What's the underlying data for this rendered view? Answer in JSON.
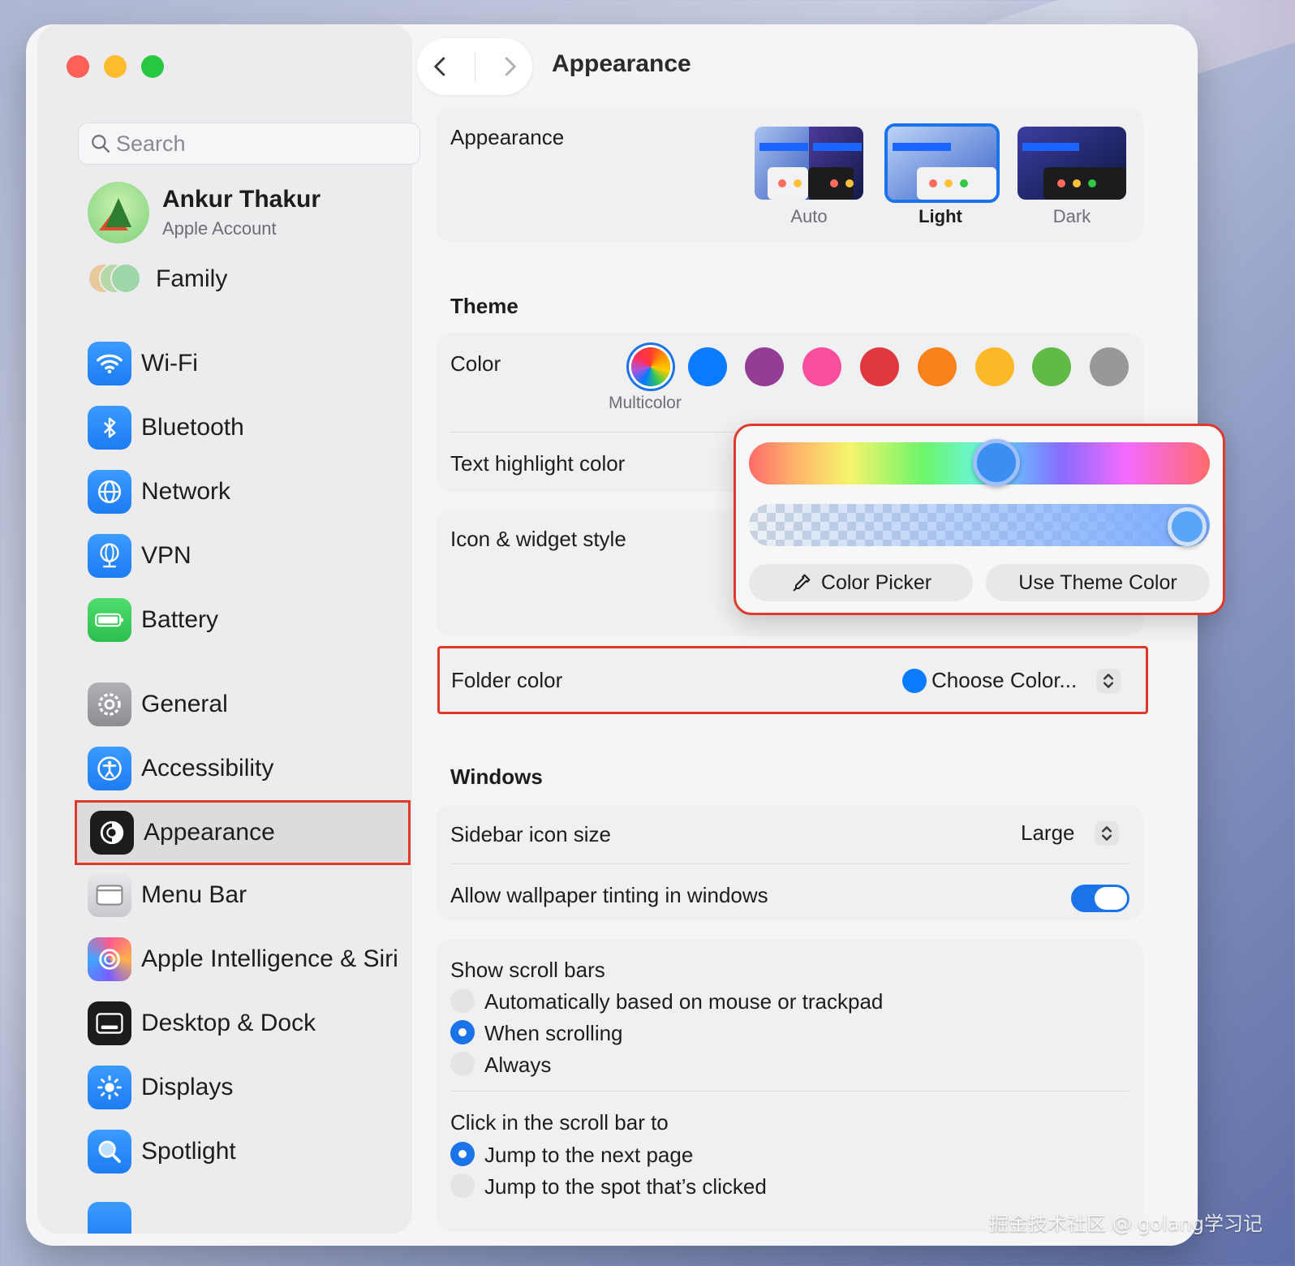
{
  "window": {
    "title": "Appearance"
  },
  "sidebar": {
    "search_placeholder": "Search",
    "account": {
      "name": "Ankur Thakur",
      "subtitle": "Apple Account"
    },
    "family_label": "Family",
    "items": [
      {
        "label": "Wi-Fi",
        "icon": "wifi-icon"
      },
      {
        "label": "Bluetooth",
        "icon": "bluetooth-icon"
      },
      {
        "label": "Network",
        "icon": "globe-icon"
      },
      {
        "label": "VPN",
        "icon": "vpn-globe-icon"
      },
      {
        "label": "Battery",
        "icon": "battery-icon"
      },
      {
        "label": "General",
        "icon": "gear-icon"
      },
      {
        "label": "Accessibility",
        "icon": "accessibility-icon"
      },
      {
        "label": "Appearance",
        "icon": "appearance-icon",
        "selected": true
      },
      {
        "label": "Menu Bar",
        "icon": "menu-bar-icon"
      },
      {
        "label": "Apple Intelligence & Siri",
        "icon": "siri-icon"
      },
      {
        "label": "Desktop & Dock",
        "icon": "dock-icon"
      },
      {
        "label": "Displays",
        "icon": "sun-icon"
      },
      {
        "label": "Spotlight",
        "icon": "magnifier-icon"
      }
    ]
  },
  "main": {
    "appearance": {
      "label": "Appearance",
      "options": [
        {
          "label": "Auto",
          "selected": false
        },
        {
          "label": "Light",
          "selected": true
        },
        {
          "label": "Dark",
          "selected": false
        }
      ]
    },
    "theme": {
      "title": "Theme",
      "color_label": "Color",
      "selected_color": "Multicolor",
      "swatches": [
        "multicolor",
        "#0a7aff",
        "#953d96",
        "#f74f9e",
        "#e0383e",
        "#f7821b",
        "#fcb827",
        "#62ba46",
        "#989898"
      ],
      "text_highlight_label": "Text highlight color",
      "icon_widget_label": "Icon & widget style",
      "popover": {
        "hue_level": 0.57,
        "alpha_level": 1.0,
        "color_picker_label": "Color Picker",
        "use_theme_label": "Use Theme Color"
      },
      "folder_color_label": "Folder color",
      "folder_color_value": "Choose Color...",
      "folder_color_dot": "#0a7aff"
    },
    "windows": {
      "title": "Windows",
      "sidebar_icon_size_label": "Sidebar icon size",
      "sidebar_icon_size_value": "Large",
      "wallpaper_tinting_label": "Allow wallpaper tinting in windows",
      "wallpaper_tinting_on": true,
      "scroll_bars_label": "Show scroll bars",
      "scroll_bars_options": [
        {
          "label": "Automatically based on mouse or trackpad",
          "selected": false
        },
        {
          "label": "When scrolling",
          "selected": true
        },
        {
          "label": "Always",
          "selected": false
        }
      ],
      "click_scroll_label": "Click in the scroll bar to",
      "click_scroll_options": [
        {
          "label": "Jump to the next page",
          "selected": true
        },
        {
          "label": "Jump to the spot that’s clicked",
          "selected": false
        }
      ]
    }
  },
  "watermark": "掘金技术社区 @ golang学习记",
  "colors": {
    "accent": "#1a73e8",
    "highlight_border": "#e0382b"
  }
}
